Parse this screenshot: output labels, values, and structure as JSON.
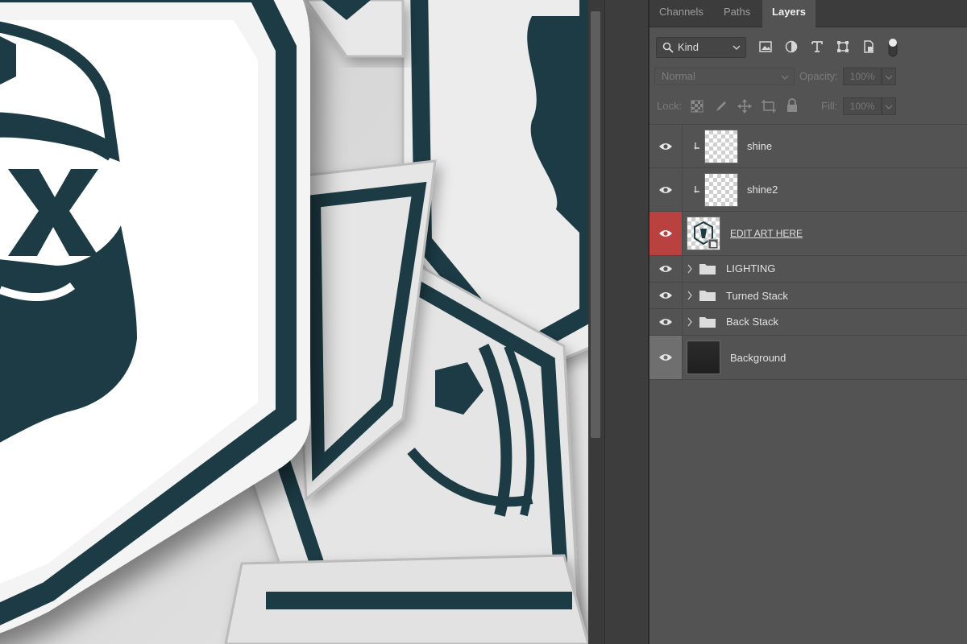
{
  "tabs": [
    {
      "label": "Channels",
      "active": false
    },
    {
      "label": "Paths",
      "active": false
    },
    {
      "label": "Layers",
      "active": true
    }
  ],
  "filter": {
    "kind_label": "Kind"
  },
  "blend": {
    "mode": "Normal",
    "opacity_label": "Opacity:",
    "opacity_value": "100%"
  },
  "lock": {
    "label": "Lock:",
    "fill_label": "Fill:",
    "fill_value": "100%"
  },
  "layers": [
    {
      "name": "shine",
      "type": "clipped-pixel",
      "selected": false
    },
    {
      "name": "shine2",
      "type": "clipped-pixel",
      "selected": false
    },
    {
      "name": "EDIT ART HERE",
      "type": "smart-object",
      "selected": true
    },
    {
      "name": "LIGHTING",
      "type": "group",
      "selected": false
    },
    {
      "name": "Turned Stack",
      "type": "group",
      "selected": false
    },
    {
      "name": "Back Stack",
      "type": "group",
      "selected": false
    },
    {
      "name": "Background",
      "type": "background",
      "selected": false
    }
  ],
  "colors": {
    "selected_eye_bg": "#b9413f",
    "background_eye_bg": "#6f6f6f",
    "art_dark": "#1a3a44",
    "panel_bg": "#535353"
  }
}
